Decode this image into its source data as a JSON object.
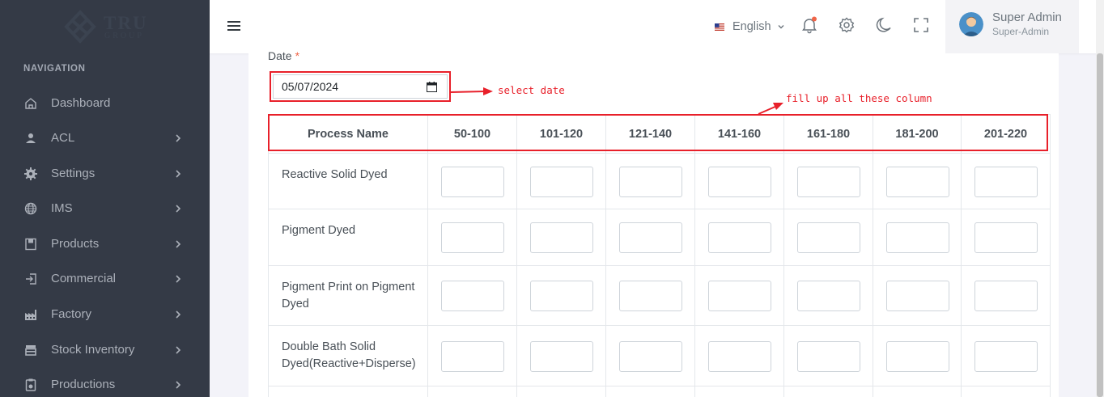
{
  "brand": {
    "name": "TRU",
    "sub": "GROUP"
  },
  "sidebar": {
    "heading": "NAVIGATION",
    "items": [
      {
        "label": "Dashboard",
        "icon": "home-icon",
        "has_children": false
      },
      {
        "label": "ACL",
        "icon": "user-icon",
        "has_children": true
      },
      {
        "label": "Settings",
        "icon": "gear-icon",
        "has_children": true
      },
      {
        "label": "IMS",
        "icon": "globe-icon",
        "has_children": true
      },
      {
        "label": "Products",
        "icon": "product-box-icon",
        "has_children": true
      },
      {
        "label": "Commercial",
        "icon": "login-arrow-icon",
        "has_children": true
      },
      {
        "label": "Factory",
        "icon": "factory-icon",
        "has_children": true
      },
      {
        "label": "Stock Inventory",
        "icon": "store-icon",
        "has_children": true
      },
      {
        "label": "Productions",
        "icon": "clipboard-icon",
        "has_children": true
      }
    ]
  },
  "header": {
    "language": "English",
    "user": {
      "name": "Super Admin",
      "role": "Super-Admin"
    },
    "icons": [
      "menu-icon",
      "notification-bell-icon",
      "settings-gear-icon",
      "dark-mode-moon-icon",
      "fullscreen-icon"
    ]
  },
  "form": {
    "date_label": "Date",
    "date_required_mark": "*",
    "date_value": "05/07/2024"
  },
  "annotations": {
    "date_note": "select date",
    "columns_note": "fill up all these column"
  },
  "table": {
    "columns": [
      "Process Name",
      "50-100",
      "101-120",
      "121-140",
      "141-160",
      "161-180",
      "181-200",
      "201-220"
    ],
    "rows": [
      {
        "process": "Reactive Solid Dyed"
      },
      {
        "process": "Pigment Dyed"
      },
      {
        "process": "Pigment Print on Pigment Dyed"
      },
      {
        "process": "Double Bath Solid Dyed(Reactive+Disperse)"
      }
    ]
  },
  "colors": {
    "sidebar_bg": "#343a46",
    "annotation_red": "#e8202a",
    "required_red": "#f06548"
  }
}
